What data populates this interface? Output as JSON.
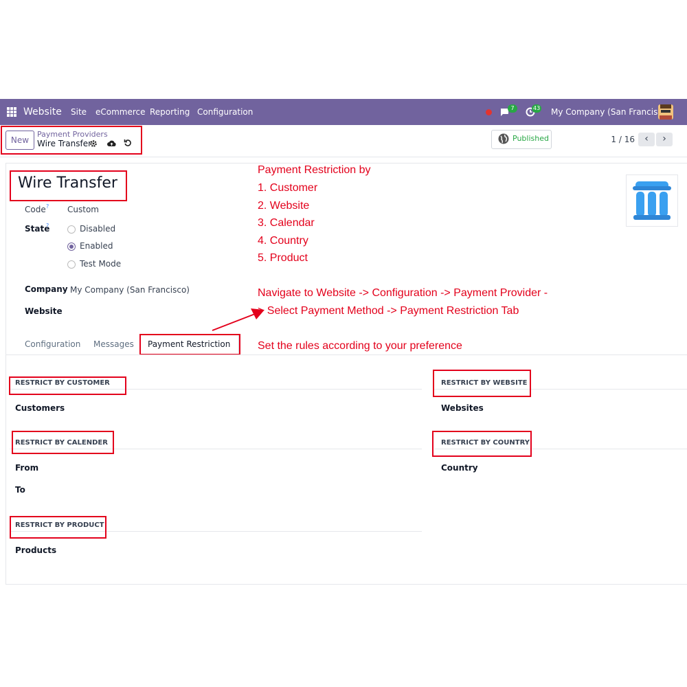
{
  "navbar": {
    "app_name": "Website",
    "menus": [
      "Site",
      "eCommerce",
      "Reporting",
      "Configuration"
    ],
    "chat_count": "7",
    "activity_count": "43",
    "company": "My Company (San Francisco)"
  },
  "control_panel": {
    "new_label": "New",
    "breadcrumb_parent": "Payment Providers",
    "breadcrumb_current": "Wire Transfer",
    "published_label": "Published",
    "pager": "1 / 16"
  },
  "form": {
    "title": "Wire Transfer",
    "code_label": "Code",
    "code_value": "Custom",
    "help_mark": "?",
    "state_label": "State",
    "state_options": [
      "Disabled",
      "Enabled",
      "Test Mode"
    ],
    "state_selected": "Enabled",
    "company_label": "Company",
    "company_value": "My Company (San Francisco)",
    "website_label": "Website",
    "tabs": [
      "Configuration",
      "Messages",
      "Payment Restriction"
    ],
    "active_tab": "Payment Restriction"
  },
  "restrictions": {
    "customer": {
      "title": "RESTRICT BY CUSTOMER",
      "fields": [
        "Customers"
      ]
    },
    "calendar": {
      "title": "RESTRICT BY CALENDER",
      "fields": [
        "From",
        "To"
      ]
    },
    "product": {
      "title": "RESTRICT BY PRODUCT",
      "fields": [
        "Products"
      ]
    },
    "website": {
      "title": "RESTRICT BY WEBSITE",
      "fields": [
        "Websites"
      ]
    },
    "country": {
      "title": "RESTRICT BY COUNTRY",
      "fields": [
        "Country"
      ]
    }
  },
  "annotation": {
    "heading": "Payment Restriction by",
    "items": [
      "1. Customer",
      "2. Website",
      "3. Calendar",
      "4. Country",
      "5. Product"
    ],
    "nav_line1": "Navigate to Website -> Configuration -> Payment Provider -",
    "nav_line2": "> Select Payment Method -> Payment Restriction Tab",
    "rules": "Set the rules according to your preference"
  },
  "colors": {
    "brand": "#71639e",
    "annotation_red": "#e3001b",
    "badge_green": "#28a745",
    "bank_icon_blue": "#3aa0f0"
  }
}
